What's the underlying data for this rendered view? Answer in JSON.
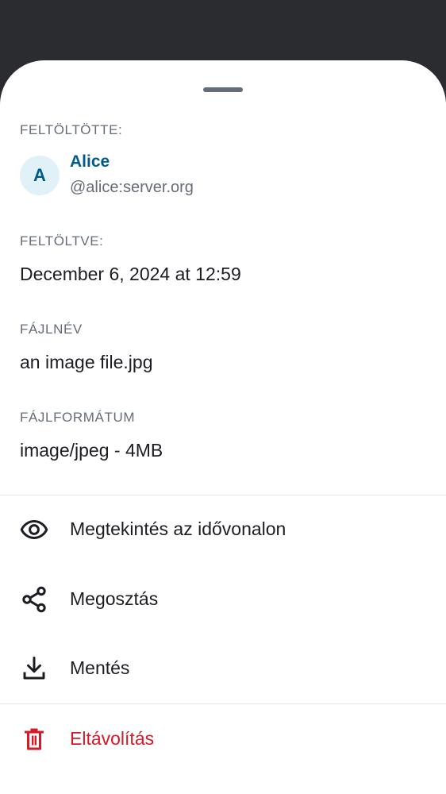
{
  "uploader": {
    "label": "FELTÖLTÖTTE:",
    "avatar_initial": "A",
    "name": "Alice",
    "user_id": "@alice:server.org"
  },
  "uploaded": {
    "label": "FELTÖLTVE:",
    "value": "December 6, 2024 at 12:59"
  },
  "filename": {
    "label": "FÁJLNÉV",
    "value": "an image file.jpg"
  },
  "fileformat": {
    "label": "FÁJLFORMÁTUM",
    "value": "image/jpeg - 4MB"
  },
  "actions": {
    "view_in_timeline": {
      "label": "Megtekintés az idővonalon",
      "icon": "eye-icon"
    },
    "share": {
      "label": "Megosztás",
      "icon": "share-icon"
    },
    "save": {
      "label": "Mentés",
      "icon": "download-icon"
    },
    "remove": {
      "label": "Eltávolítás",
      "icon": "trash-icon"
    }
  },
  "colors": {
    "background_dim": "#2b2c2f",
    "accent": "#005c8b",
    "danger": "#d51928",
    "secondary_text": "#656d77"
  }
}
